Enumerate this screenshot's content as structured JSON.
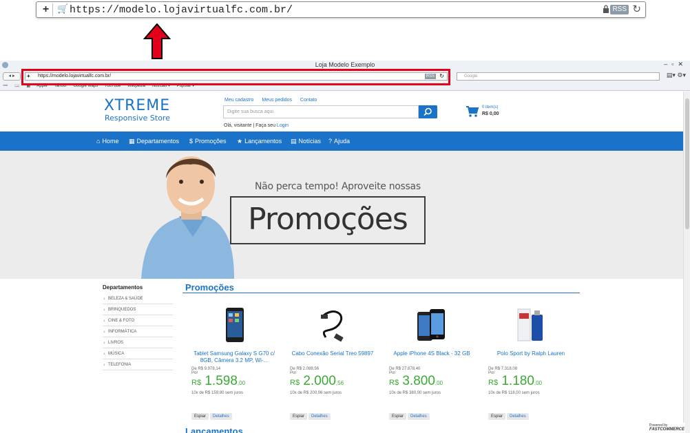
{
  "zoom": {
    "url": "https://modelo.lojavirtualfc.com.br/",
    "rss": "RSS"
  },
  "browser": {
    "title": "Loja Modelo Exemplo",
    "url": "https://modelo.lojavirtualfc.com.br/",
    "rss": "RSS",
    "search_placeholder": "Google",
    "bookmarks": [
      "Apple",
      "Yahoo!",
      "Google Maps",
      "YouTube",
      "Wikipedia",
      "Notícias ▾",
      "Popular ▾"
    ]
  },
  "header": {
    "logo_main": "XTREME",
    "logo_sub": "Responsive Store",
    "links": [
      "Meu cadastro",
      "Meus pedidos",
      "Contato"
    ],
    "search_placeholder": "Digite sua busca aqui",
    "welcome": "Olá, visitante | Faça seu",
    "login": "Login",
    "cart_items": "0 item(s)",
    "cart_total": "R$ 0,00"
  },
  "nav": {
    "items": [
      {
        "label": "Home",
        "icon": "home-icon"
      },
      {
        "label": "Departamentos",
        "icon": "grid-icon"
      },
      {
        "label": "Promoções",
        "icon": "dollar-icon"
      },
      {
        "label": "Lançamentos",
        "icon": "star-icon"
      },
      {
        "label": "Notícias",
        "icon": "news-icon"
      },
      {
        "label": "Ajuda",
        "icon": "help-icon"
      }
    ]
  },
  "banner": {
    "tagline": "Não perca tempo! Aproveite nossas",
    "headline": "Promoções"
  },
  "departments": {
    "title": "Departamentos",
    "items": [
      "BELEZA & SAÚDE",
      "BRINQUEDOS",
      "CINE & FOTO",
      "INFORMÁTICA",
      "LIVROS",
      "MÚSICA",
      "TELEFONIA"
    ]
  },
  "promotions": {
    "title": "Promoções",
    "products": [
      {
        "name": "Tablet Samsung Galaxy S G70 c/ 8GB, Câmera 3.2 MP, Wi-...",
        "old": "De R$ 9.978,14",
        "por": "Por",
        "currency": "R$",
        "price": "1.598",
        "cents": ",00",
        "installments": "10x de R$ 159,80 sem juros"
      },
      {
        "name": "Cabo Conexão Serial Treo 59897",
        "old": "De R$ 2.088,56",
        "por": "Por",
        "currency": "R$",
        "price": "2.000",
        "cents": ",56",
        "installments": "10x de R$ 200,06 sem juros"
      },
      {
        "name": "Apple iPhone 4S Black - 32 GB",
        "old": "De R$ 27.878,40",
        "por": "Por",
        "currency": "R$",
        "price": "3.800",
        "cents": ",00",
        "installments": "10x de R$ 380,00 sem juros"
      },
      {
        "name": "Polo Sport by Ralph Lauren",
        "old": "De R$ 7.318,08",
        "por": "Por",
        "currency": "R$",
        "price": "1.180",
        "cents": ",00",
        "installments": "10x de R$ 118,00 sem juros"
      }
    ],
    "btn_spy": "Espiar",
    "btn_details": "Detalhes"
  },
  "next_section": "Lançamentos",
  "powered": {
    "line1": "Powered by",
    "line2": "FASTCOMMERCE"
  },
  "colors": {
    "brand_blue": "#1a73c8",
    "price_green": "#3aaa35",
    "callout_red": "#e3001b"
  }
}
